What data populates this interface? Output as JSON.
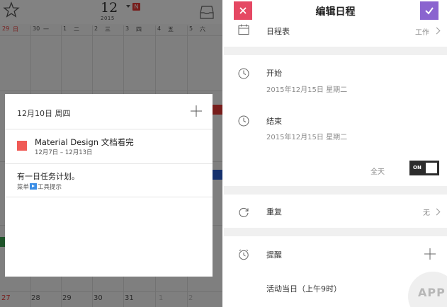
{
  "calendar": {
    "month": "12",
    "year": "2015",
    "badge": "N",
    "weekdays": [
      {
        "num": "29",
        "cn": "日"
      },
      {
        "num": "30",
        "cn": "一"
      },
      {
        "num": "1",
        "cn": "二"
      },
      {
        "num": "2",
        "cn": "三"
      },
      {
        "num": "3",
        "cn": "四"
      },
      {
        "num": "4",
        "cn": "五"
      },
      {
        "num": "5",
        "cn": "六"
      }
    ],
    "bottom_days": [
      "27",
      "28",
      "29",
      "30",
      "31",
      "1",
      "2"
    ]
  },
  "popup": {
    "date_title": "12月10日 周四",
    "event_title": "Material Design 文档看完",
    "event_range": "12月7日 – 12月13日",
    "task_title": "有一日任务计划。",
    "task_sub_prefix": "菜单",
    "task_sub_suffix": "工具提示"
  },
  "editor": {
    "title": "编辑日程",
    "schedule_label": "日程表",
    "schedule_value": "工作",
    "start_label": "开始",
    "start_value": "2015年12月15日 星期二",
    "end_label": "结束",
    "end_value": "2015年12月15日 星期二",
    "allday_label": "全天",
    "toggle_text": "ON",
    "repeat_label": "重复",
    "repeat_value": "无",
    "reminder_label": "提醒",
    "reminder_item": "活动当日（上午9时）",
    "watermark": "APP"
  },
  "colors": {
    "close": "#e54863",
    "confirm": "#8a64cf",
    "event": "#f05a55",
    "weekend": "#e53935"
  }
}
